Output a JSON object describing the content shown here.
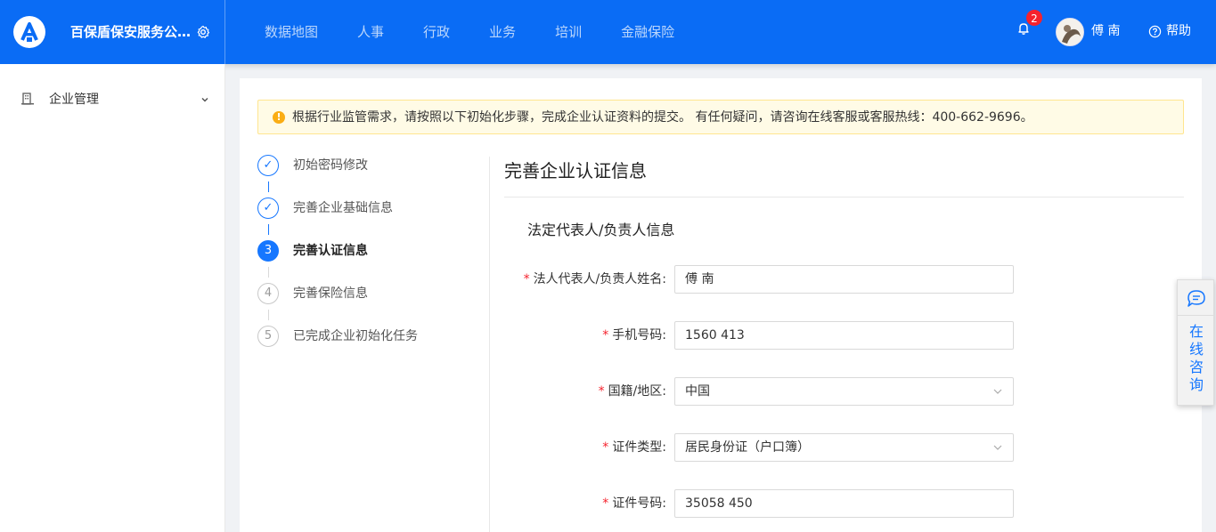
{
  "header": {
    "company_name": "百保盾保安服务公司...",
    "nav_items": [
      "数据地图",
      "人事",
      "行政",
      "业务",
      "培训",
      "金融保险"
    ],
    "notification_count": "2",
    "username": "傅    南",
    "help_label": "帮助"
  },
  "sidebar": {
    "items": [
      {
        "label": "企业管理",
        "icon": "building-icon"
      }
    ]
  },
  "alert": {
    "text": "根据行业监管需求，请按照以下初始化步骤，完成企业认证资料的提交。 有任何疑问，请咨询在线客服或客服热线：400-662-9696。"
  },
  "steps": [
    {
      "marker": "✓",
      "label": "初始密码修改",
      "status": "finished"
    },
    {
      "marker": "✓",
      "label": "完善企业基础信息",
      "status": "finished"
    },
    {
      "marker": "3",
      "label": "完善认证信息",
      "status": "active"
    },
    {
      "marker": "4",
      "label": "完善保险信息",
      "status": "wait"
    },
    {
      "marker": "5",
      "label": "已完成企业初始化任务",
      "status": "wait"
    }
  ],
  "form": {
    "title": "完善企业认证信息",
    "section_title": "法定代表人/负责人信息",
    "fields": [
      {
        "label": "法人代表人/负责人姓名:",
        "value": "傅    南",
        "type": "input"
      },
      {
        "label": "手机号码:",
        "value": "1560        413",
        "type": "input"
      },
      {
        "label": "国籍/地区:",
        "value": "中国",
        "type": "select"
      },
      {
        "label": "证件类型:",
        "value": "居民身份证（户口簿）",
        "type": "select"
      },
      {
        "label": "证件号码:",
        "value": "35058               450",
        "type": "input"
      }
    ]
  },
  "consult": {
    "label": "在线咨询"
  },
  "colors": {
    "primary": "#0a6cf5",
    "accent": "#1677ff",
    "warning": "#faad14",
    "required": "#f5222d"
  }
}
